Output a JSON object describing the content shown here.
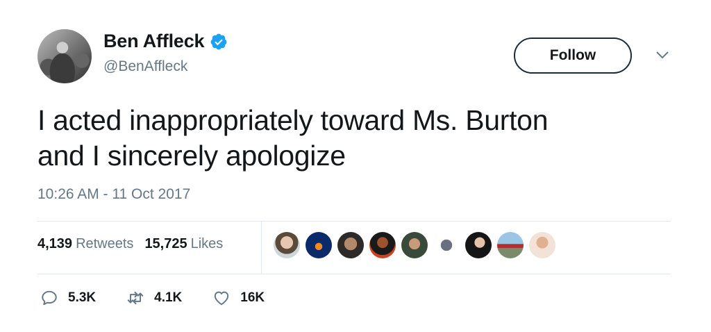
{
  "author": {
    "name": "Ben Affleck",
    "handle": "@BenAffleck",
    "verified": true,
    "avatar_icon": "profile-photo"
  },
  "follow_button": {
    "label": "Follow"
  },
  "menu": {
    "icon": "chevron-down-icon"
  },
  "tweet": {
    "line1": "I acted inappropriately toward Ms. Burton",
    "line2": "and I sincerely apologize",
    "timestamp": "10:26 AM - 11 Oct 2017"
  },
  "stats": {
    "retweets_count": "4,139",
    "retweets_label": "Retweets",
    "likes_count": "15,725",
    "likes_label": "Likes"
  },
  "liked_by_avatars": 9,
  "actions": {
    "replies": "5.3K",
    "retweets": "4.1K",
    "likes": "16K"
  },
  "colors": {
    "verified_blue": "#1da1f2",
    "secondary_text": "#657786",
    "divider": "#e1e8ed"
  }
}
